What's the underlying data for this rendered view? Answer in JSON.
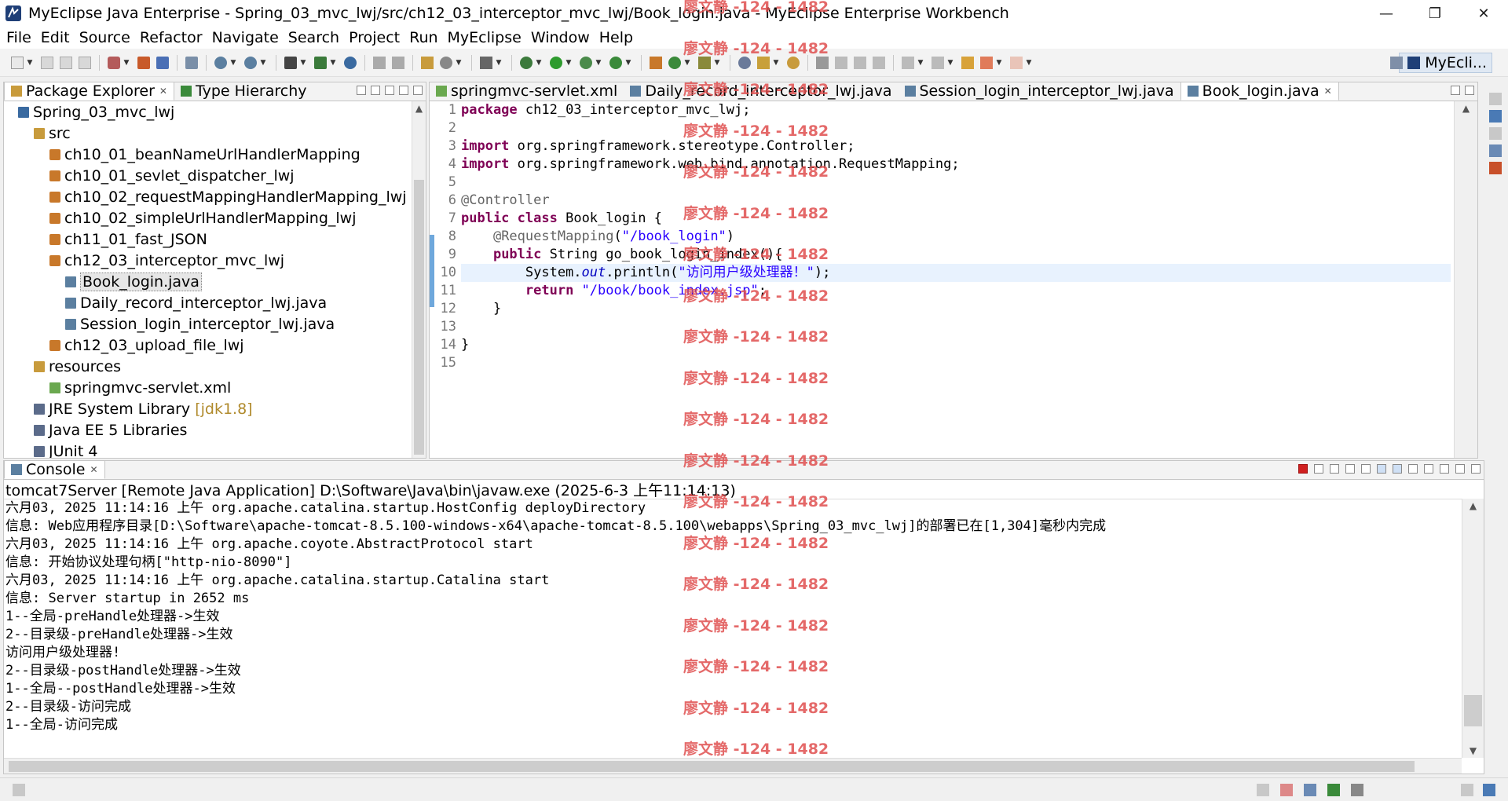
{
  "window": {
    "title": "MyEclipse Java Enterprise - Spring_03_mvc_lwj/src/ch12_03_interceptor_mvc_lwj/Book_login.java - MyEclipse Enterprise Workbench",
    "minimize": "—",
    "maximize": "❐",
    "close": "✕"
  },
  "menu": [
    "File",
    "Edit",
    "Source",
    "Refactor",
    "Navigate",
    "Search",
    "Project",
    "Run",
    "MyEclipse",
    "Window",
    "Help"
  ],
  "perspective": {
    "label": "MyEcli..."
  },
  "left_panel": {
    "tabs": [
      {
        "label": "Package Explorer",
        "close": "✕"
      },
      {
        "label": "Type Hierarchy"
      }
    ],
    "tree": [
      {
        "label": "Spring_03_mvc_lwj",
        "depth": 0,
        "icon": "project-icon"
      },
      {
        "label": "src",
        "depth": 1,
        "icon": "source-folder-icon"
      },
      {
        "label": "ch10_01_beanNameUrlHandlerMapping",
        "depth": 2,
        "icon": "package-icon"
      },
      {
        "label": "ch10_01_sevlet_dispatcher_lwj",
        "depth": 2,
        "icon": "package-icon"
      },
      {
        "label": "ch10_02_requestMappingHandlerMapping_lwj",
        "depth": 2,
        "icon": "package-icon"
      },
      {
        "label": "ch10_02_simpleUrlHandlerMapping_lwj",
        "depth": 2,
        "icon": "package-icon"
      },
      {
        "label": "ch11_01_fast_JSON",
        "depth": 2,
        "icon": "package-icon"
      },
      {
        "label": "ch12_03_interceptor_mvc_lwj",
        "depth": 2,
        "icon": "package-icon"
      },
      {
        "label": "Book_login.java",
        "depth": 3,
        "icon": "java-file-icon",
        "selected": true
      },
      {
        "label": "Daily_record_interceptor_lwj.java",
        "depth": 3,
        "icon": "java-file-icon"
      },
      {
        "label": "Session_login_interceptor_lwj.java",
        "depth": 3,
        "icon": "java-file-icon"
      },
      {
        "label": "ch12_03_upload_file_lwj",
        "depth": 2,
        "icon": "package-icon"
      },
      {
        "label": "resources",
        "depth": 1,
        "icon": "source-folder-icon"
      },
      {
        "label": "springmvc-servlet.xml",
        "depth": 2,
        "icon": "xml-file-icon"
      },
      {
        "label": "JRE System Library",
        "decor": "[jdk1.8]",
        "depth": 1,
        "icon": "library-icon"
      },
      {
        "label": "Java EE 5 Libraries",
        "depth": 1,
        "icon": "library-icon"
      },
      {
        "label": "JUnit 4",
        "depth": 1,
        "icon": "library-icon"
      }
    ]
  },
  "editor": {
    "tabs": [
      {
        "label": "springmvc-servlet.xml",
        "icon": "xml-file-icon"
      },
      {
        "label": "Daily_record_interceptor_lwj.java",
        "icon": "java-file-icon"
      },
      {
        "label": "Session_login_interceptor_lwj.java",
        "icon": "java-file-icon"
      },
      {
        "label": "Book_login.java",
        "icon": "java-file-icon",
        "active": true,
        "close": "✕"
      }
    ],
    "line_numbers": [
      "1",
      "2",
      "3",
      "4",
      "5",
      "6",
      "7",
      "8",
      "9",
      "10",
      "11",
      "12",
      "13",
      "14",
      "15"
    ],
    "lines": [
      [
        {
          "t": "package",
          "c": "kw"
        },
        {
          "t": " ch12_03_interceptor_mvc_lwj;"
        }
      ],
      [],
      [
        {
          "t": "import",
          "c": "kw"
        },
        {
          "t": " org.springframework.stereotype.Controller;"
        }
      ],
      [
        {
          "t": "import",
          "c": "kw"
        },
        {
          "t": " org.springframework.web.bind.annotation.RequestMapping;"
        }
      ],
      [],
      [
        {
          "t": "@Controller",
          "c": "ann"
        }
      ],
      [
        {
          "t": "public",
          "c": "kw"
        },
        {
          "t": " "
        },
        {
          "t": "class",
          "c": "kw"
        },
        {
          "t": " Book_login {"
        }
      ],
      [
        {
          "t": "    "
        },
        {
          "t": "@RequestMapping",
          "c": "ann"
        },
        {
          "t": "("
        },
        {
          "t": "\"/book_login\"",
          "c": "str"
        },
        {
          "t": ")"
        }
      ],
      [
        {
          "t": "    "
        },
        {
          "t": "public",
          "c": "kw"
        },
        {
          "t": " String go_book_login_index(){"
        }
      ],
      [
        {
          "t": "        System."
        },
        {
          "t": "out",
          "c": "fld"
        },
        {
          "t": ".println("
        },
        {
          "t": "\"访问用户级处理器！\"",
          "c": "str"
        },
        {
          "t": ");"
        }
      ],
      [
        {
          "t": "        "
        },
        {
          "t": "return",
          "c": "kw"
        },
        {
          "t": " "
        },
        {
          "t": "\"/book/book_index.jsp\"",
          "c": "str"
        },
        {
          "t": ";"
        }
      ],
      [
        {
          "t": "    }"
        }
      ],
      [],
      [
        {
          "t": "}"
        }
      ],
      []
    ]
  },
  "console": {
    "tab": {
      "label": "Console",
      "close": "✕"
    },
    "header": "tomcat7Server [Remote Java Application] D:\\Software\\Java\\bin\\javaw.exe (2025-6-3 上午11:14:13)",
    "lines": [
      "六月03, 2025 11:14:16 上午 org.apache.catalina.startup.HostConfig deployDirectory",
      "信息: Web应用程序目录[D:\\Software\\apache-tomcat-8.5.100-windows-x64\\apache-tomcat-8.5.100\\webapps\\Spring_03_mvc_lwj]的部署已在[1,304]毫秒内完成",
      "六月03, 2025 11:14:16 上午 org.apache.coyote.AbstractProtocol start",
      "信息: 开始协议处理句柄[\"http-nio-8090\"]",
      "六月03, 2025 11:14:16 上午 org.apache.catalina.startup.Catalina start",
      "信息: Server startup in 2652 ms",
      "1--全局-preHandle处理器->生效",
      "2--目录级-preHandle处理器->生效",
      "访问用户级处理器!",
      "2--目录级-postHandle处理器->生效",
      "1--全局--postHandle处理器->生效",
      "2--目录级-访问完成",
      "1--全局-访问完成"
    ]
  },
  "watermark": "廖文静 -124 - 1482",
  "colors": {
    "keyword": "#7f0055",
    "string": "#2a00ff",
    "annotation": "#646464",
    "watermark": "#e05050",
    "current_line": "#e8f2fe"
  }
}
